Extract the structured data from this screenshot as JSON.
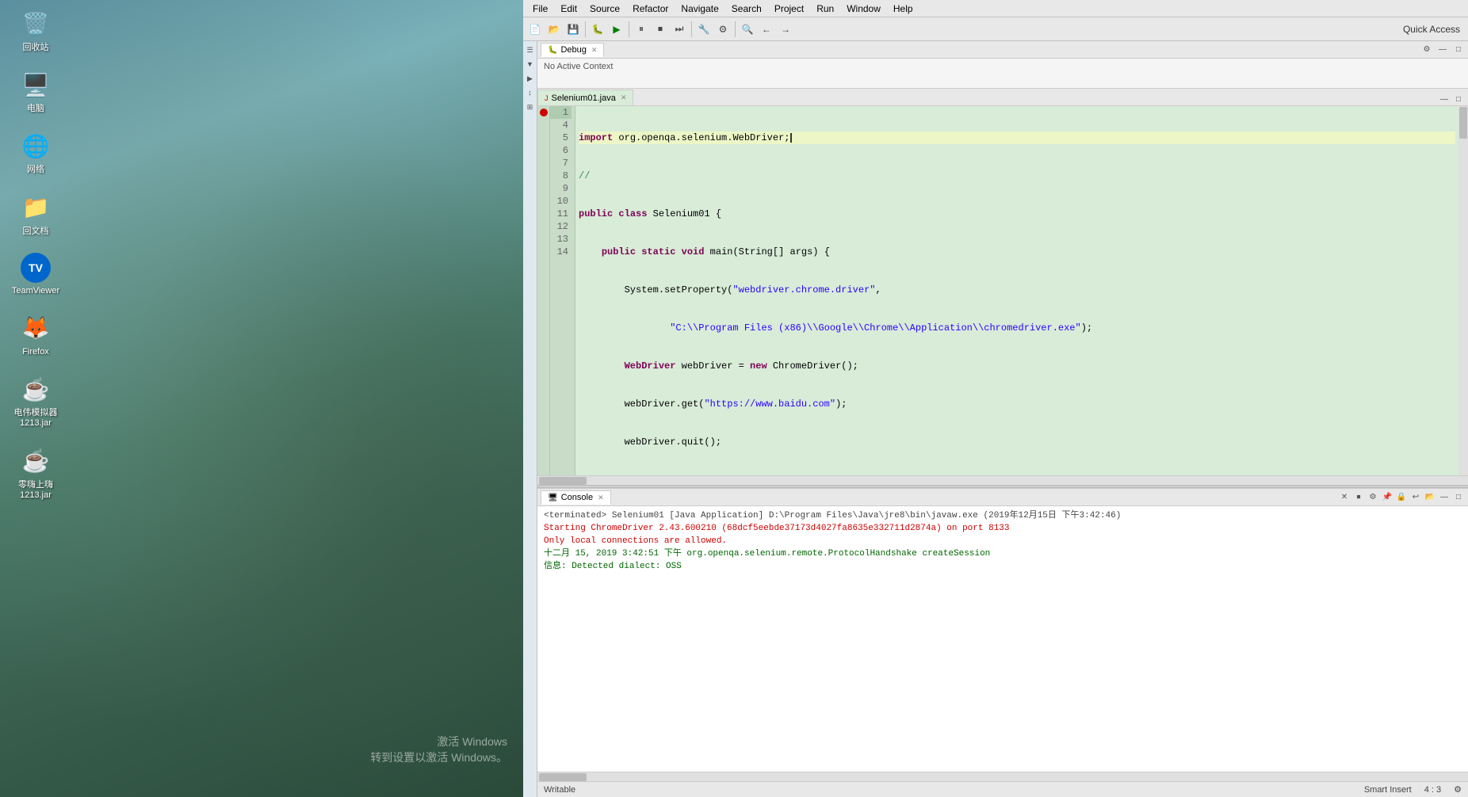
{
  "desktop": {
    "icons": [
      {
        "id": "recycle",
        "label": "回收站",
        "emoji": "🗑️"
      },
      {
        "id": "computer",
        "label": "电脑",
        "emoji": "🖥️"
      },
      {
        "id": "network",
        "label": "网络",
        "emoji": "🌐"
      },
      {
        "id": "docs",
        "label": "回文档",
        "emoji": "📁"
      },
      {
        "id": "teamviewer",
        "label": "TeamViewer",
        "emoji": "🔵"
      },
      {
        "id": "firefox",
        "label": "Firefox",
        "emoji": "🦊"
      },
      {
        "id": "java1",
        "label": "电伟模拟器\n1213.jar",
        "emoji": "☕"
      },
      {
        "id": "java2",
        "label": "零嗨上嗨\n1213.jar",
        "emoji": "☕"
      }
    ],
    "watermark_line1": "激活 Windows",
    "watermark_line2": "转到设置以激活 Windows。"
  },
  "eclipse": {
    "menu": {
      "items": [
        "File",
        "Edit",
        "Source",
        "Refactor",
        "Navigate",
        "Search",
        "Project",
        "Run",
        "Window",
        "Help"
      ]
    },
    "toolbar": {
      "quick_access_label": "Quick Access"
    },
    "debug_panel": {
      "tab_label": "Debug",
      "tab_icon": "🐛",
      "content": "No Active Context"
    },
    "editor": {
      "tab_label": "Selenium01.java",
      "tab_modified": true,
      "code_lines": [
        {
          "num": "1",
          "has_breakpoint": true,
          "content": "import org.openqa.selenium.WebDriver;",
          "classes": [
            "import-line"
          ]
        },
        {
          "num": "4",
          "content": "//",
          "classes": []
        },
        {
          "num": "5",
          "content": "public class Selenium01 {",
          "classes": []
        },
        {
          "num": "6",
          "content": "    public static void main(String[] args) {",
          "classes": []
        },
        {
          "num": "7",
          "content": "        System.setProperty(\"webdriver.chrome.driver\",",
          "classes": []
        },
        {
          "num": "8",
          "content": "                \"C:\\\\Program Files (x86)\\\\Google\\\\Chrome\\\\Application\\\\chromedriver.exe\");",
          "classes": []
        },
        {
          "num": "9",
          "content": "        WebDriver webDriver = new ChromeDriver();",
          "classes": []
        },
        {
          "num": "10",
          "content": "        webDriver.get(\"https://www.baidu.com\");",
          "classes": []
        },
        {
          "num": "11",
          "content": "        webDriver.quit();",
          "classes": []
        },
        {
          "num": "12",
          "content": "    }",
          "classes": []
        },
        {
          "num": "13",
          "content": "}",
          "classes": []
        },
        {
          "num": "14",
          "content": "",
          "classes": []
        }
      ]
    },
    "console": {
      "tab_label": "Console",
      "terminated_line": "<terminated> Selenium01 [Java Application] D:\\Program Files\\Java\\jre8\\bin\\javaw.exe (2019年12月15日 下午3:42:46)",
      "output_lines": [
        "Starting ChromeDriver 2.43.600210 (68dcf5eebde37173d4027fa8635e332711d2874a) on port 8133",
        "Only local connections are allowed.",
        "十二月 15, 2019 3:42:51 下午 org.openqa.selenium.remote.ProtocolHandshake createSession",
        "信息: Detected dialect: OSS"
      ]
    },
    "status_bar": {
      "writable": "Writable",
      "insert_mode": "Smart Insert",
      "position": "4 : 3"
    }
  }
}
